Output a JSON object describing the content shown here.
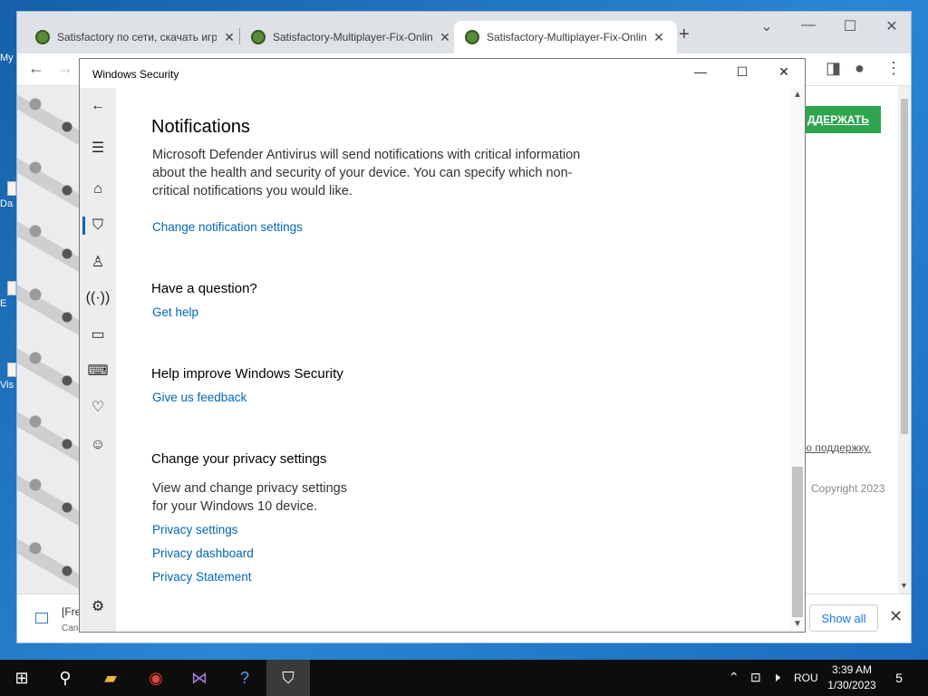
{
  "desktop": {
    "icon_labels": [
      "My",
      "Da",
      "E",
      "Vis"
    ]
  },
  "browser": {
    "tabs": [
      {
        "title": "Satisfactory по сети, скачать игру",
        "active": false
      },
      {
        "title": "Satisfactory-Multiplayer-Fix-Online",
        "active": false
      },
      {
        "title": "Satisfactory-Multiplayer-Fix-Online",
        "active": true
      }
    ],
    "page": {
      "support_button": "ДДЕРЖАТЬ",
      "support_link": "ю поддержку.",
      "copyright": "Copyright 2023"
    },
    "download_bar": {
      "file_name": "[Fre",
      "status": "Canc",
      "show_all": "Show all"
    }
  },
  "security": {
    "window_title": "Windows Security",
    "notifications": {
      "heading": "Notifications",
      "description": "Microsoft Defender Antivirus will send notifications with critical information about the health and security of your device. You can specify which non-critical notifications you would like.",
      "link": "Change notification settings"
    },
    "question": {
      "heading": "Have a question?",
      "link": "Get help"
    },
    "improve": {
      "heading": "Help improve Windows Security",
      "link": "Give us feedback"
    },
    "privacy": {
      "heading": "Change your privacy settings",
      "description": "View and change privacy settings for your Windows 10 device.",
      "links": [
        "Privacy settings",
        "Privacy dashboard",
        "Privacy Statement"
      ]
    },
    "nav_icons": [
      "back-arrow-icon",
      "hamburger-menu-icon",
      "home-icon",
      "shield-icon",
      "account-icon",
      "firewall-network-icon",
      "app-browser-control-icon",
      "device-security-icon",
      "device-health-icon",
      "family-options-icon",
      "settings-gear-icon"
    ]
  },
  "taskbar": {
    "language": "ROU",
    "time": "3:39 AM",
    "date": "1/30/2023",
    "notification_count": "5"
  },
  "colors": {
    "link_blue": "#0067b8",
    "nav_background": "#ededed",
    "taskbar": "#0d0d0d",
    "support_green": "#2ea44f"
  }
}
